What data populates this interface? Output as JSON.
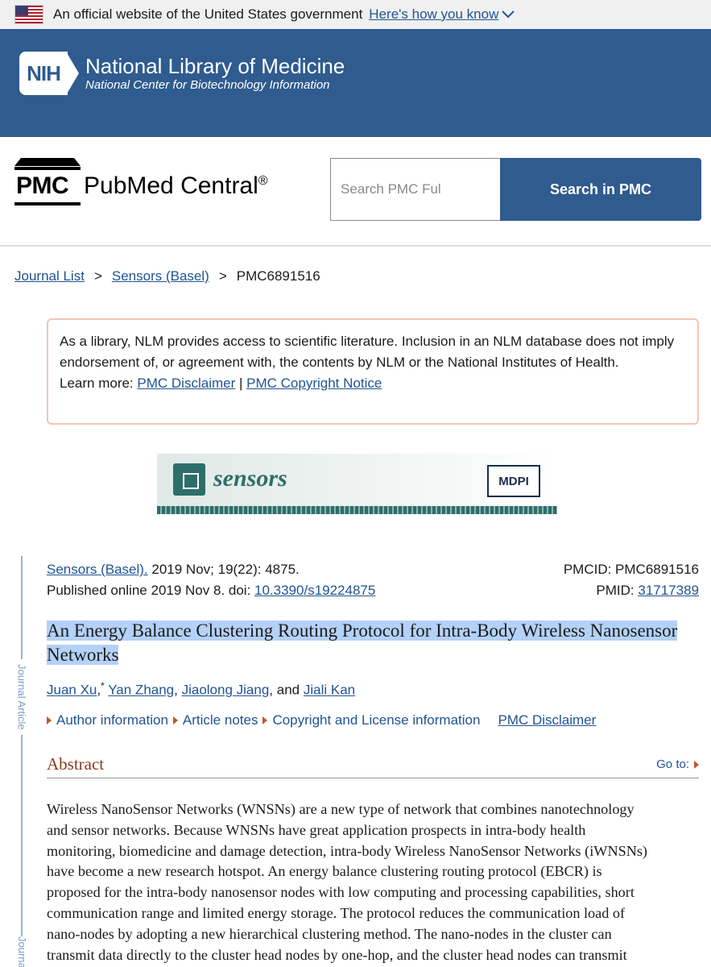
{
  "gov_banner": {
    "text": "An official website of the United States government",
    "link": "Here's how you know"
  },
  "nlm": {
    "badge": "NIH",
    "title": "National Library of Medicine",
    "subtitle": "National Center for Biotechnology Information"
  },
  "pmc": {
    "mark": "PMC",
    "name": "PubMed Central",
    "reg": "®",
    "search_placeholder": "Search PMC Ful",
    "search_button": "Search in PMC"
  },
  "breadcrumb": {
    "items": [
      "Journal List",
      "Sensors (Basel)",
      "PMC6891516"
    ],
    "separator": ">"
  },
  "disclaimer": {
    "text": "As a library, NLM provides access to scientific literature. Inclusion in an NLM database does not imply endorsement of, or agreement with, the contents by NLM or the National Institutes of Health.",
    "learn_more": "Learn more:",
    "link1": "PMC Disclaimer",
    "divider": "|",
    "link2": "PMC Copyright Notice"
  },
  "journal_banner": {
    "name": "sensors",
    "publisher": "MDPI"
  },
  "side_label": "Journal Article",
  "side_label2": "Journal",
  "citation": {
    "journal": "Sensors (Basel).",
    "details": " 2019 Nov; 19(22): 4875.",
    "published": "Published online 2019 Nov 8. doi: ",
    "doi": "10.3390/s19224875",
    "pmcid": "PMCID: PMC6891516",
    "pmid_label": "PMID: ",
    "pmid": "31717389"
  },
  "article": {
    "title": "An Energy Balance Clustering Routing Protocol for Intra-Body Wireless Nanosensor Networks",
    "authors": [
      "Juan Xu",
      "Yan Zhang",
      "Jiaolong Jiang",
      "Jiali Kan"
    ],
    "corresponding_mark": "*",
    "and": "and"
  },
  "meta_links": {
    "author_info": "Author information",
    "article_notes": "Article notes",
    "copyright": "Copyright and License information",
    "disclaimer": "PMC Disclaimer"
  },
  "abstract": {
    "heading": "Abstract",
    "goto": "Go to:",
    "lines": [
      "Wireless NanoSensor Networks (WNSNs) are a new type of network that combines nanotechnology",
      "and sensor networks. Because WNSNs have great application prospects in intra-body health",
      "monitoring, biomedicine and damage detection, intra-body Wireless NanoSensor Networks (iWNSNs)",
      "have become a new research hotspot. An energy balance clustering routing protocol (EBCR) is",
      "proposed for the intra-body nanosensor nodes with low computing and processing capabilities, short",
      "communication range and limited energy storage. The protocol reduces the communication load of",
      "nano-nodes by adopting a new hierarchical clustering method. The nano-nodes in the cluster can",
      "transmit data directly to the cluster head nodes by one-hop, and the cluster head nodes can transmit"
    ]
  },
  "colors": {
    "header_blue": "#2f5b8f",
    "link_blue": "#205493",
    "abstract_heading": "#8b3a1a",
    "title_highlight": "#b4d1f7",
    "disclaimer_border": "#f2c5b5"
  }
}
